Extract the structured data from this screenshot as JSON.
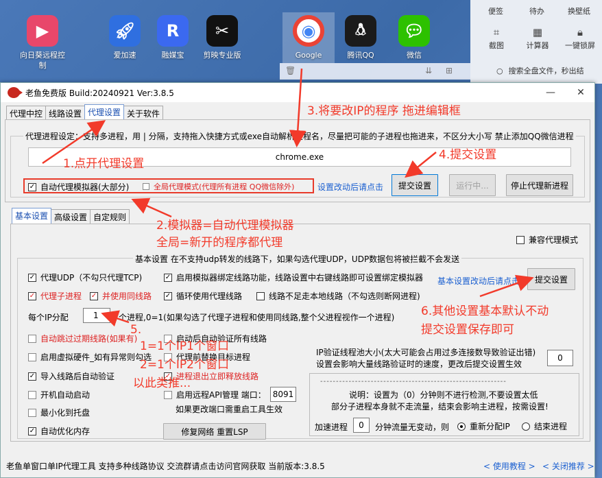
{
  "desktop": {
    "icons": [
      {
        "label": "向日葵远程控制",
        "name": "sunlogin-icon",
        "color": "#e8476a"
      },
      {
        "label": "爱加速",
        "name": "ajiasu-icon",
        "color": "#2f6fe0"
      },
      {
        "label": "融媒宝",
        "name": "rongmeibao-icon",
        "color": "#3b69f0"
      },
      {
        "label": "剪映专业版",
        "name": "capcut-icon",
        "color": "#111111"
      },
      {
        "label": "Google",
        "name": "chrome-icon",
        "color": "#ffffff"
      },
      {
        "label": "腾讯QQ",
        "name": "qq-icon",
        "color": "#1b1b1b"
      },
      {
        "label": "微信",
        "name": "wechat-icon",
        "color": "#2dc100"
      }
    ]
  },
  "right_panel": {
    "tabs": [
      "便签",
      "待办",
      "换壁纸"
    ],
    "items": [
      "截图",
      "计算器",
      "一键锁屏"
    ],
    "search_placeholder": "搜索全盘文件，秒出结"
  },
  "window": {
    "title": "老鱼免费版 Build:20240921 Ver:3.8.5",
    "tabs": [
      "代理中控",
      "线路设置",
      "代理设置",
      "关于软件"
    ],
    "active_tab": "代理设置",
    "proxy_group": {
      "legend": "代理进程设定：支持多进程，用 | 分隔，支持拖入快捷方式或exe自动解析进程名，尽量把可能的子进程也拖进来，不区分大小写 禁止添加QQ微信进程",
      "process_value": "chrome.exe",
      "auto_proxy_label": "自动代理模拟器(大部分)",
      "global_proxy_label": "全局代理模式(代理所有进程 QQ微信除外)",
      "hint": "设置改动后请点击",
      "submit_label": "提交设置",
      "running_label": "运行中...",
      "stop_label": "停止代理新进程"
    },
    "sub_tabs": [
      "基本设置",
      "高级设置",
      "自定规则"
    ],
    "compat_label": "兼容代理模式",
    "basic": {
      "legend": "基本设置 在不支持udp转发的线路下，如果勾选代理UDP，UDP数据包将被拦截不会发送",
      "hint": "基本设置改动后请点击",
      "submit_label": "提交设置",
      "col1": [
        {
          "label": "代理UDP（不勾只代理TCP)",
          "checked": true,
          "red": false
        },
        {
          "label": "代理子进程",
          "checked": true,
          "red": true
        },
        {
          "label": "自动跳过过期线路(如果有)",
          "checked": false,
          "red": true
        },
        {
          "label": "启用虚拟硬件_如有异常则勾选",
          "checked": false,
          "red": false
        },
        {
          "label": "导入线路后自动验证",
          "checked": true,
          "red": false
        },
        {
          "label": "开机自动启动",
          "checked": false,
          "red": false
        },
        {
          "label": "最小化到托盘",
          "checked": false,
          "red": false
        },
        {
          "label": "自动优化内存",
          "checked": true,
          "red": false
        }
      ],
      "same_line_label": "并使用同线路",
      "per_ip_label": "每个IP分配",
      "per_ip_value": "1",
      "per_ip_desc": "个进程,0=1(如果勾选了代理子进程和使用同线路,整个父进程视作一个进程)",
      "col2": [
        {
          "label": "启用模拟器绑定线路功能，线路设置中右键线路即可设置绑定模拟器",
          "checked": true
        },
        {
          "label": "循环使用代理线路",
          "checked": true
        },
        {
          "label": "启动后自动验证所有线路",
          "checked": false
        },
        {
          "label": "代理前替换目标进程",
          "checked": false
        },
        {
          "label": "进程退出立即释放线路",
          "checked": true
        },
        {
          "label": "启用远程API管理 端口：",
          "checked": false
        }
      ],
      "local_only_label": "线路不足走本地线路（不勾选则断网进程)",
      "api_port": "8091",
      "api_note": "如果更改端口需重启工具生效",
      "repair_label": "修复网络 重置LSP",
      "ip_pool_text1": "IP验证线程池大小(太大可能会占用过多连接数导致验证出错)",
      "ip_pool_text2": "设置会影响大量线路验证时的速度，更改后提交设置生效",
      "ip_pool_value": "0",
      "dashes": "-----------------------------------------------------------",
      "note1": "说明：设置为（0）分钟则不进行检测,不要设置太低",
      "note2": "部分子进程本身就不走流量，结束会影响主进程，按需设置!",
      "accel_label": "加速进程",
      "accel_value": "0",
      "accel_desc": "分钟流量无变动，则",
      "realloc_label": "重新分配IP",
      "end_label": "结束进程"
    },
    "status": {
      "text": "老鱼单窗口单IP代理工具 支持多种线路协议 交流群请点击访问官网获取  当前版本:3.8.5",
      "tutorial": "< 使用教程 >",
      "close_recommend": "< 关闭推荐 >"
    }
  },
  "annotations": {
    "a1": "1.点开代理设置",
    "a2": "2.模拟器=自动代理模拟器",
    "a2b": "全局=新开的程序都代理",
    "a3": "3.将要改IP的程序 拖进编辑框",
    "a4": "4.提交设置",
    "a5": "5.",
    "a5b": "1=1个IP1个窗口",
    "a5c": "2=1个IP2个窗口",
    "a5d": "以此类推...",
    "a6": "6.其他设置基本默认不动",
    "a6b": "提交设置保存即可"
  },
  "colors": {
    "annotation": "#f23a2a",
    "link": "#1a5fd0",
    "red_label": "#dd2222"
  }
}
